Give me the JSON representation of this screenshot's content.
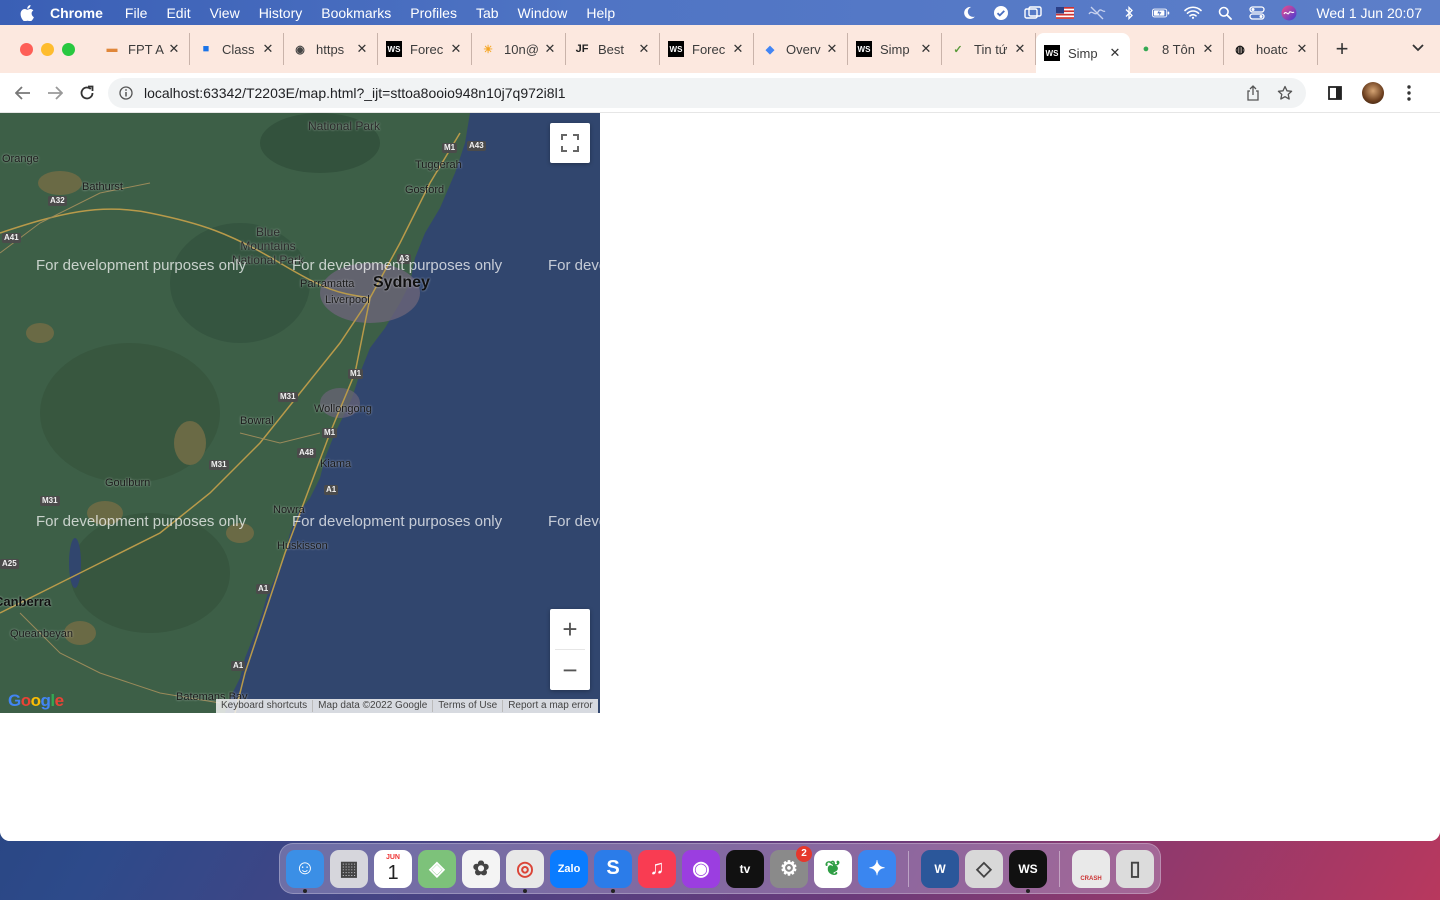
{
  "menubar": {
    "app_name": "Chrome",
    "items": [
      "File",
      "Edit",
      "View",
      "History",
      "Bookmarks",
      "Profiles",
      "Tab",
      "Window",
      "Help"
    ],
    "clock": "Wed 1 Jun  20:07"
  },
  "tabs": [
    {
      "title": "FPT A",
      "icon": "fpt-icon",
      "active": false
    },
    {
      "title": "Class",
      "icon": "classroom-icon",
      "active": false
    },
    {
      "title": "https",
      "icon": "globe-icon",
      "active": false
    },
    {
      "title": "Forec",
      "icon": "webstorm-icon",
      "active": false
    },
    {
      "title": "10n@",
      "icon": "sun-icon",
      "active": false
    },
    {
      "title": "Best",
      "icon": "jf-icon",
      "active": false
    },
    {
      "title": "Forec",
      "icon": "webstorm-icon",
      "active": false
    },
    {
      "title": "Overv",
      "icon": "gcp-icon",
      "active": false
    },
    {
      "title": "Simp",
      "icon": "webstorm-icon",
      "active": false
    },
    {
      "title": "Tin tứ",
      "icon": "check-icon",
      "active": false
    },
    {
      "title": "Simp",
      "icon": "webstorm-icon",
      "active": true
    },
    {
      "title": "8 Tôn",
      "icon": "maps-pin-icon",
      "active": false
    },
    {
      "title": "hoatc",
      "icon": "github-icon",
      "active": false
    }
  ],
  "toolbar": {
    "url": "localhost:63342/T2203E/map.html?_ijt=sttoa8ooio948n10j7q972i8l1"
  },
  "map": {
    "watermark": "For development purposes only",
    "watermark_cut": "For deve",
    "places": {
      "sydney": "Sydney",
      "parramatta": "Parramatta",
      "liverpool": "Liverpool",
      "wollongong": "Wollongong",
      "kiama": "Kiama",
      "nowra": "Nowra",
      "huskisson": "Huskisson",
      "bowral": "Bowral",
      "goulburn": "Goulburn",
      "canberra": "Canberra",
      "queanbeyan": "Queanbeyan",
      "bathurst": "Bathurst",
      "orange": "Orange",
      "gosford": "Gosford",
      "tuggerah": "Tuggerah",
      "batemans_bay": "Batemans Bay",
      "blue_mountains": "Blue Mountains National Park",
      "national_park": "National Park"
    },
    "roads": [
      "M1",
      "A43",
      "A32",
      "A41",
      "A3",
      "M31",
      "M1",
      "A48",
      "M31",
      "M1",
      "A1",
      "M31",
      "A1",
      "A1",
      "A25"
    ],
    "google_logo": "Google",
    "attribution": [
      "Keyboard shortcuts",
      "Map data ©2022 Google",
      "Terms of Use",
      "Report a map error"
    ],
    "zoom_in": "+",
    "zoom_out": "−"
  },
  "dock": {
    "apps": [
      {
        "name": "Finder",
        "icon": "finder-icon",
        "color": "#3b8fe6",
        "running": true
      },
      {
        "name": "Launchpad",
        "icon": "launchpad-icon",
        "color": "#d6d6dc",
        "running": false
      },
      {
        "name": "Calendar",
        "icon": "calendar-icon",
        "color": "#ffffff",
        "label": "1",
        "month": "JUN",
        "running": false
      },
      {
        "name": "Maps",
        "icon": "maps-icon",
        "color": "#7dc27a",
        "running": false
      },
      {
        "name": "Photos",
        "icon": "photos-icon",
        "color": "#f4f4f4",
        "running": false
      },
      {
        "name": "Chrome",
        "icon": "chrome-icon",
        "color": "#e8e8e8",
        "running": true
      },
      {
        "name": "Zalo",
        "icon": "zalo-icon",
        "color": "#0a7cff",
        "label": "Zalo",
        "running": false
      },
      {
        "name": "Skype",
        "icon": "skype-icon",
        "color": "#2b7ce9",
        "label": "S",
        "running": true
      },
      {
        "name": "Music",
        "icon": "music-icon",
        "color": "#f93c52",
        "running": false
      },
      {
        "name": "Podcasts",
        "icon": "podcasts-icon",
        "color": "#9b3ee0",
        "running": false
      },
      {
        "name": "Apple TV",
        "icon": "tv-icon",
        "color": "#111111",
        "label": "tv",
        "running": false
      },
      {
        "name": "System Preferences",
        "icon": "settings-icon",
        "color": "#8a8a8a",
        "badge": "2",
        "running": false
      },
      {
        "name": "MongoDB Compass",
        "icon": "mongodb-icon",
        "color": "#ffffff",
        "running": false
      },
      {
        "name": "Safari",
        "icon": "safari-icon",
        "color": "#3a86f0",
        "running": false
      }
    ],
    "apps_right": [
      {
        "name": "Word",
        "icon": "word-icon",
        "color": "#2b579a",
        "label": "W",
        "running": false
      },
      {
        "name": "Unity",
        "icon": "unity-icon",
        "color": "#d8d8d8",
        "running": false
      },
      {
        "name": "WebStorm",
        "icon": "webstorm-icon",
        "color": "#111111",
        "label": "WS",
        "running": true
      }
    ],
    "trash_area": [
      {
        "name": "Crash Report",
        "icon": "crash-report-icon",
        "color": "#e9e9e9",
        "label": "CRASH"
      },
      {
        "name": "Trash",
        "icon": "trash-icon",
        "color": "#dcdcdc"
      }
    ]
  },
  "colors": {
    "menubar": "#4a6fc0",
    "tabstrip": "#fce8df",
    "map_land": "#3d5f47",
    "map_sea": "#31466e"
  }
}
